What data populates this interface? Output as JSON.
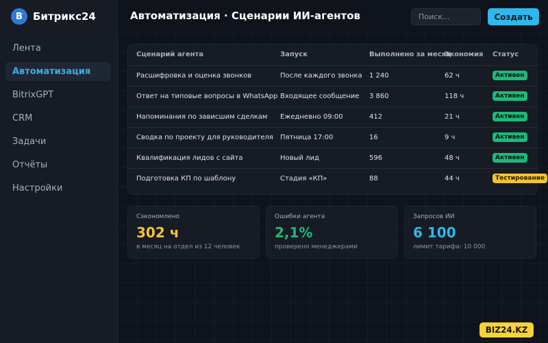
{
  "brand": {
    "logo_letter": "B",
    "name": "Битрикс24"
  },
  "sidebar": {
    "items": [
      {
        "label": "Лента",
        "active": false
      },
      {
        "label": "Автоматизация",
        "active": true
      },
      {
        "label": "BitrixGPT",
        "active": false
      },
      {
        "label": "CRM",
        "active": false
      },
      {
        "label": "Задачи",
        "active": false
      },
      {
        "label": "Отчёты",
        "active": false
      },
      {
        "label": "Настройки",
        "active": false
      }
    ]
  },
  "header": {
    "title": "Автоматизация · Сценарии ИИ-агентов",
    "search_placeholder": "Поиск...",
    "create_label": "Создать"
  },
  "table": {
    "headers": [
      "Сценарий агента",
      "Запуск",
      "Выполнено за месяц",
      "Экономия",
      "Статус"
    ],
    "rows": [
      {
        "scenario": "Расшифровка и оценка звонков",
        "trigger": "После каждого звонка",
        "done": "1 240",
        "saving": "62 ч",
        "status": "Активен",
        "status_type": "ok"
      },
      {
        "scenario": "Ответ на типовые вопросы в WhatsApp",
        "trigger": "Входящее сообщение",
        "done": "3 860",
        "saving": "118 ч",
        "status": "Активен",
        "status_type": "ok"
      },
      {
        "scenario": "Напоминания по зависшим сделкам",
        "trigger": "Ежедневно 09:00",
        "done": "412",
        "saving": "21 ч",
        "status": "Активен",
        "status_type": "ok"
      },
      {
        "scenario": "Сводка по проекту для руководителя",
        "trigger": "Пятница 17:00",
        "done": "16",
        "saving": "9 ч",
        "status": "Активен",
        "status_type": "ok"
      },
      {
        "scenario": "Квалификация лидов с сайта",
        "trigger": "Новый лид",
        "done": "596",
        "saving": "48 ч",
        "status": "Активен",
        "status_type": "ok"
      },
      {
        "scenario": "Подготовка КП по шаблону",
        "trigger": "Стадия «КП»",
        "done": "88",
        "saving": "44 ч",
        "status": "Тестирование",
        "status_type": "test"
      }
    ]
  },
  "stats": [
    {
      "label": "Сэкономлено",
      "value": "302 ч",
      "sub": "в месяц на отдел из 12 человек",
      "color": "#f4c430"
    },
    {
      "label": "Ошибки агента",
      "value": "2,1%",
      "sub": "проверено менеджерами",
      "color": "#1fb878"
    },
    {
      "label": "Запросов ИИ",
      "value": "6 100",
      "sub": "лимит тарифа: 10 000",
      "color": "#2eb8ec"
    }
  ],
  "footer_badge": "BIZ24.KZ"
}
